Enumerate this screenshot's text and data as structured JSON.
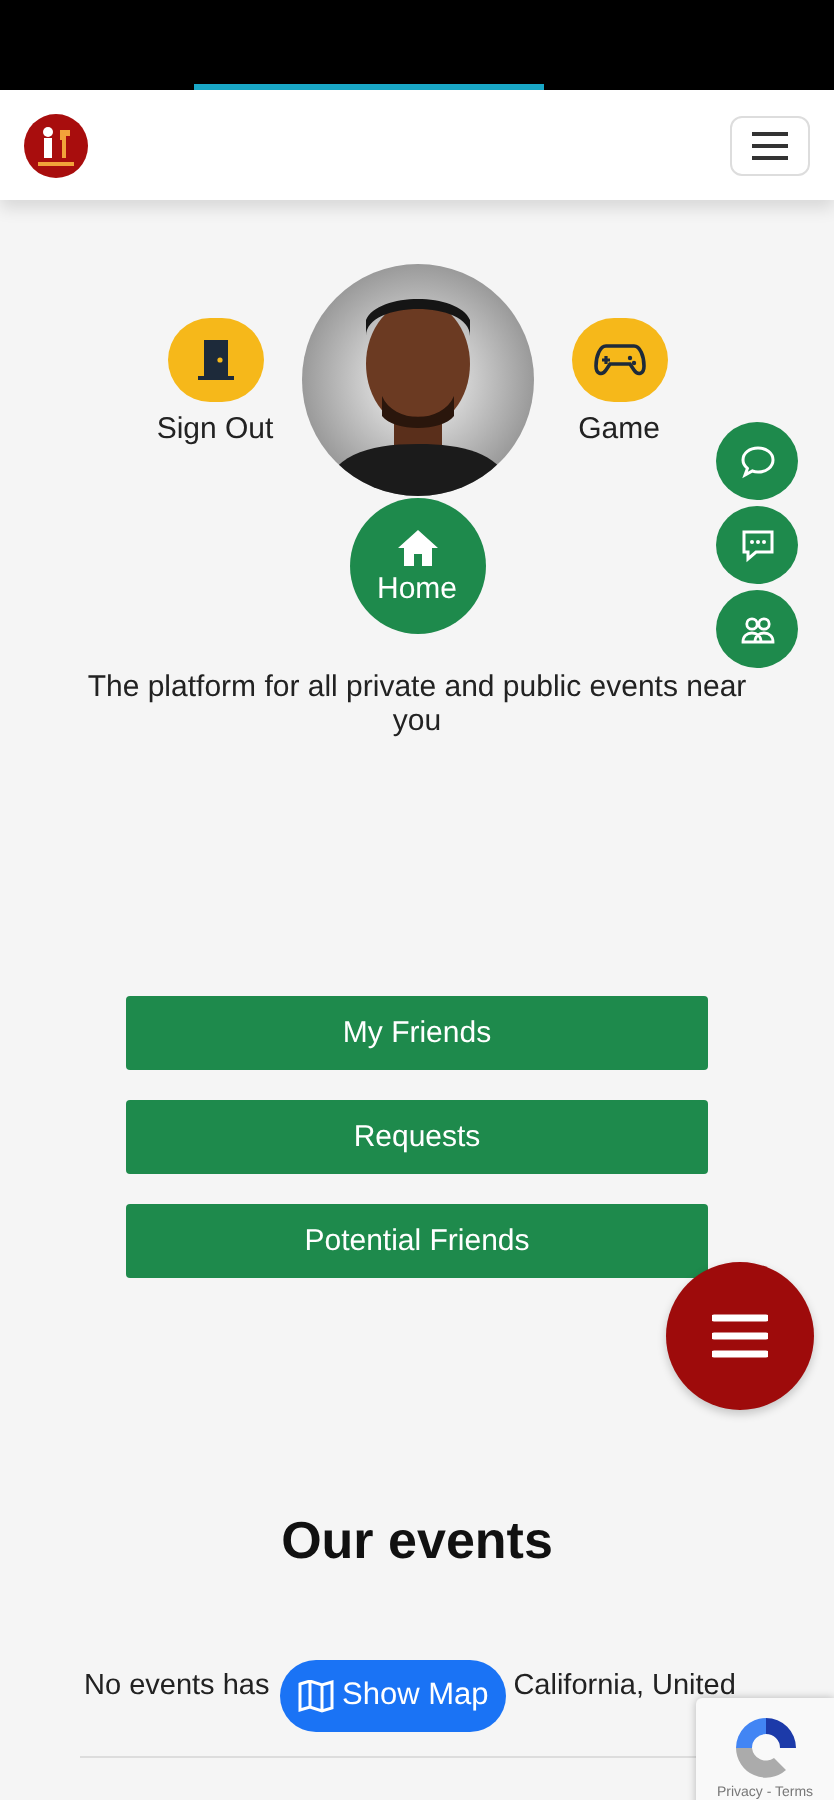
{
  "hero": {
    "actions": [
      {
        "kind": "sign-out",
        "label": "Sign Out"
      },
      {
        "kind": "game",
        "label": "Game"
      }
    ],
    "home": "Home",
    "tagline": "The platform for all private and public events near you"
  },
  "side_buttons": [
    {
      "kind": "chat"
    },
    {
      "kind": "message"
    },
    {
      "kind": "group"
    }
  ],
  "friend_buttons": [
    "My Friends",
    "Requests",
    "Potential Friends"
  ],
  "events": {
    "title": "Our events",
    "text_before": "No events has",
    "text_after": "California, United",
    "map_button": "Show Map"
  },
  "recaptcha": {
    "links": "Privacy - Terms"
  }
}
